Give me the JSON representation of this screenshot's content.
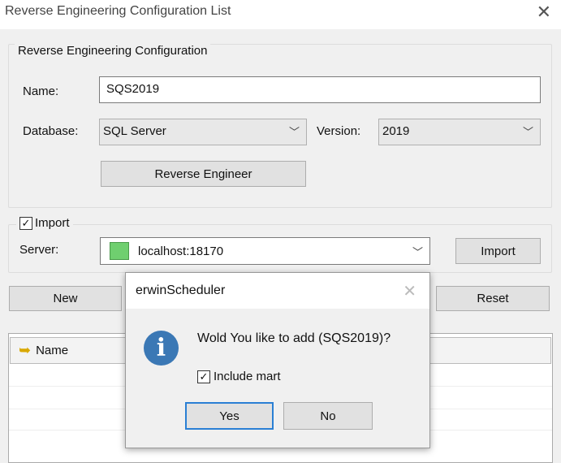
{
  "window": {
    "title": "Reverse Engineering Configuration List",
    "close": "✕"
  },
  "config": {
    "group_title": "Reverse Engineering Configuration",
    "name_label": "Name:",
    "name_value": "SQS2019",
    "database_label": "Database:",
    "database_value": "SQL Server",
    "version_label": "Version:",
    "version_value": "2019",
    "reverse_button": "Reverse Engineer"
  },
  "import": {
    "checkbox_label": "Import",
    "checked": true,
    "server_label": "Server:",
    "server_value": "localhost:18170",
    "server_color": "#6fcf6f",
    "import_button": "Import"
  },
  "buttons": {
    "new": "New",
    "reset": "Reset"
  },
  "list": {
    "columns": [
      "Name"
    ]
  },
  "dialog": {
    "title": "erwinScheduler",
    "close": "✕",
    "message": "Wold You like to add (SQS2019)?",
    "checkbox_label": "Include mart",
    "checked": true,
    "yes": "Yes",
    "no": "No"
  }
}
